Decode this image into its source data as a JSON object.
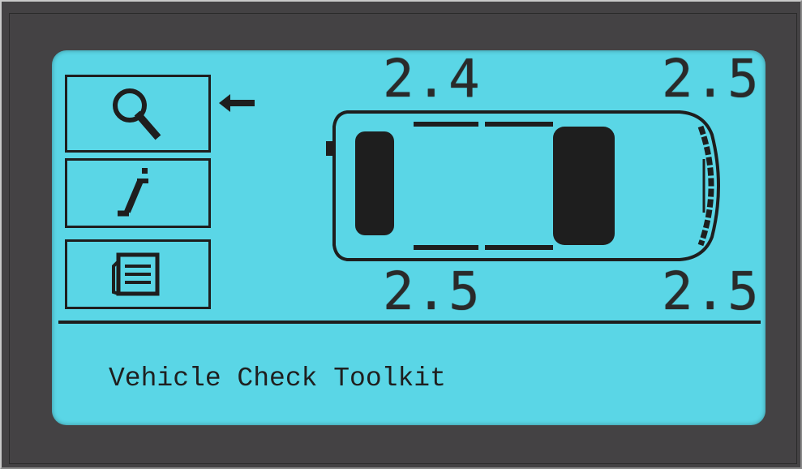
{
  "screen": {
    "background_color": "#5ad6e6",
    "ink_color": "#1e1e1e"
  },
  "menu": {
    "items": [
      {
        "icon": "search-icon",
        "selected": true
      },
      {
        "icon": "info-icon",
        "selected": false
      },
      {
        "icon": "list-icon",
        "selected": false
      }
    ],
    "selection_indicator": "arrow-left-icon"
  },
  "tires": {
    "front_left": "2.4",
    "front_right": "2.5",
    "rear_left": "2.5",
    "rear_right": "2.5"
  },
  "vehicle": {
    "icon": "car-top-view-icon"
  },
  "status_text": "Vehicle Check Toolkit"
}
